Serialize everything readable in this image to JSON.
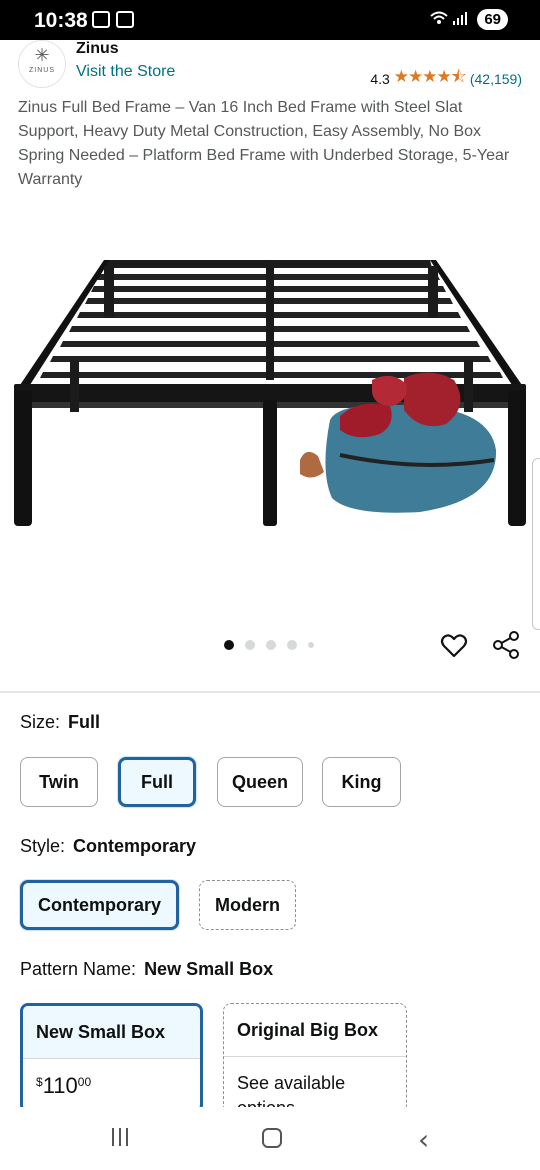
{
  "status_bar": {
    "time": "10:38",
    "battery": "69"
  },
  "store": {
    "brand_name": "Zinus",
    "logo_text": "ZINUS",
    "visit_store": "Visit the Store",
    "rating_value": "4.3",
    "rating_stars": "★★★★⯪",
    "rating_count": "(42,159)"
  },
  "product": {
    "title": "Zinus Full Bed Frame – Van 16 Inch Bed Frame with Steel Slat Support, Heavy Duty Metal Construction, Easy Assembly, No Box Spring Needed – Platform Bed Frame with Underbed Storage, 5-Year Warranty"
  },
  "carousel": {
    "dot_count": 5,
    "active_index": 0
  },
  "size": {
    "label": "Size:",
    "selected": "Full",
    "options": [
      "Twin",
      "Full",
      "Queen",
      "King"
    ]
  },
  "style": {
    "label": "Style:",
    "selected": "Contemporary",
    "options": [
      "Contemporary",
      "Modern"
    ]
  },
  "pattern": {
    "label": "Pattern Name:",
    "selected": "New Small Box",
    "options": [
      {
        "title": "New Small Box",
        "price_symbol": "$",
        "price_whole": "110",
        "price_fraction": "00"
      },
      {
        "title": "Original Big Box",
        "note": "See available options"
      }
    ]
  },
  "colors": {
    "link": "#007185",
    "star": "#de7921",
    "selected_border": "#2162a1",
    "selected_bg": "#edf8ff"
  }
}
